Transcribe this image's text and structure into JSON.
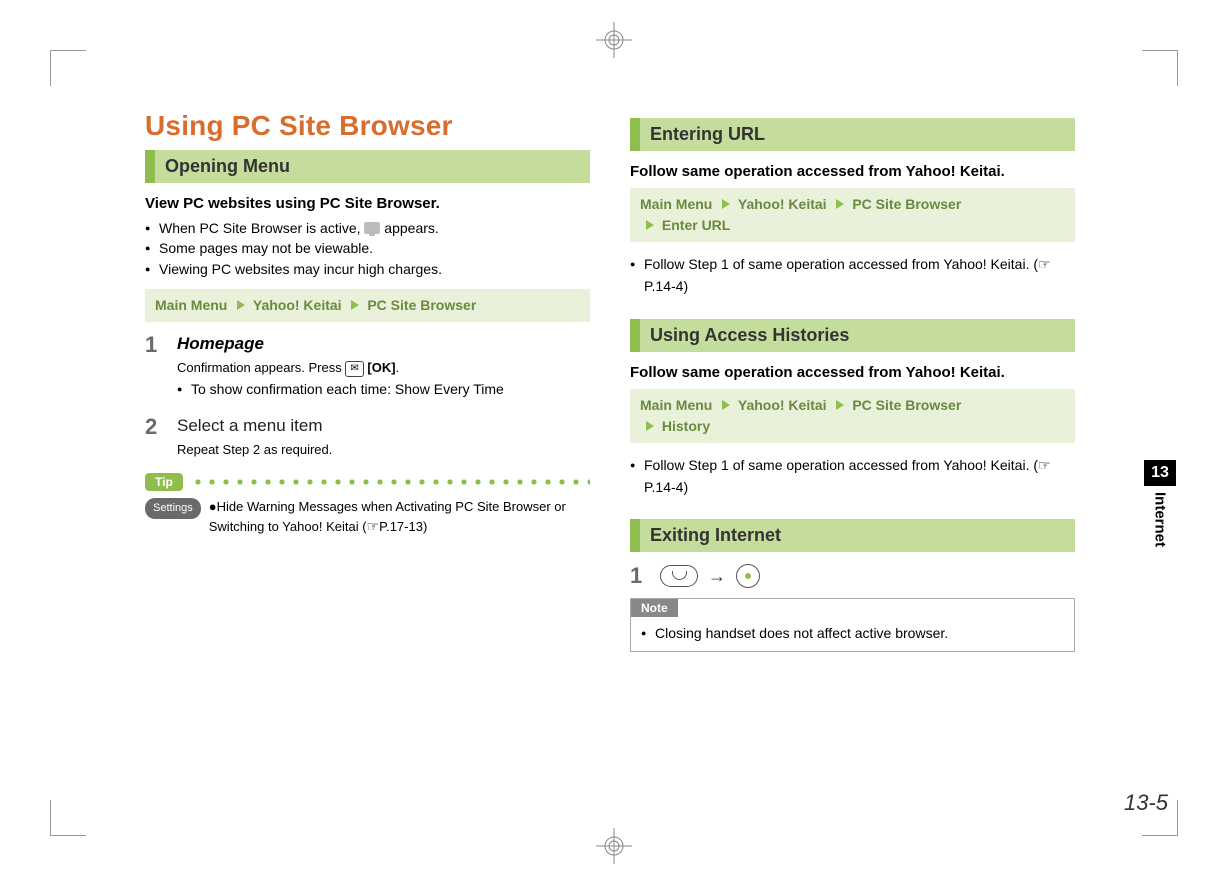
{
  "page_number": "13-5",
  "side_tab": {
    "number": "13",
    "label": "Internet"
  },
  "left": {
    "title": "Using PC Site Browser",
    "section1": {
      "heading": "Opening Menu",
      "intro": "View PC websites using PC Site Browser.",
      "bullets": [
        {
          "pre": "When PC Site Browser is active, ",
          "post": " appears."
        },
        {
          "pre": "Some pages may not be viewable.",
          "post": ""
        },
        {
          "pre": "Viewing PC websites may incur high charges.",
          "post": ""
        }
      ],
      "nav": {
        "root": "Main Menu",
        "items": [
          "Yahoo! Keitai",
          "PC Site Browser"
        ]
      },
      "steps": [
        {
          "num": "1",
          "title": "Homepage",
          "title_style": "bi",
          "sub_plain": "Confirmation appears. Press ",
          "sub_btn": "✉",
          "sub_bold": "[OK]",
          "sub_tail": ".",
          "sub2_bullet": "To show confirmation each time: ",
          "sub2_bi": "Show Every Time"
        },
        {
          "num": "2",
          "title": "Select a menu item",
          "title_style": "plain",
          "sub_plain": "Repeat Step 2 as required."
        }
      ],
      "tip_label": "Tip",
      "settings_label": "Settings",
      "settings_text_pre": "●Hide Warning Messages when Activating PC Site Browser or Switching to Yahoo! Keitai (",
      "settings_ref": "P.17-13",
      "settings_text_post": ")"
    }
  },
  "right": {
    "section1": {
      "heading": "Entering URL",
      "intro": "Follow same operation accessed from Yahoo! Keitai.",
      "nav": {
        "root": "Main Menu",
        "items": [
          "Yahoo! Keitai",
          "PC Site Browser",
          "Enter URL"
        ]
      },
      "bullet_pre": "Follow Step 1 of same operation accessed from Yahoo! Keitai. (",
      "bullet_ref": "P.14-4",
      "bullet_post": ")"
    },
    "section2": {
      "heading": "Using Access Histories",
      "intro": "Follow same operation accessed from Yahoo! Keitai.",
      "nav": {
        "root": "Main Menu",
        "items": [
          "Yahoo! Keitai",
          "PC Site Browser",
          "History"
        ]
      },
      "bullet_pre": "Follow Step 1 of same operation accessed from Yahoo! Keitai. (",
      "bullet_ref": "P.14-4",
      "bullet_post": ")"
    },
    "section3": {
      "heading": "Exiting Internet",
      "step_num": "1",
      "note_label": "Note",
      "note_text": "Closing handset does not affect active browser."
    }
  }
}
